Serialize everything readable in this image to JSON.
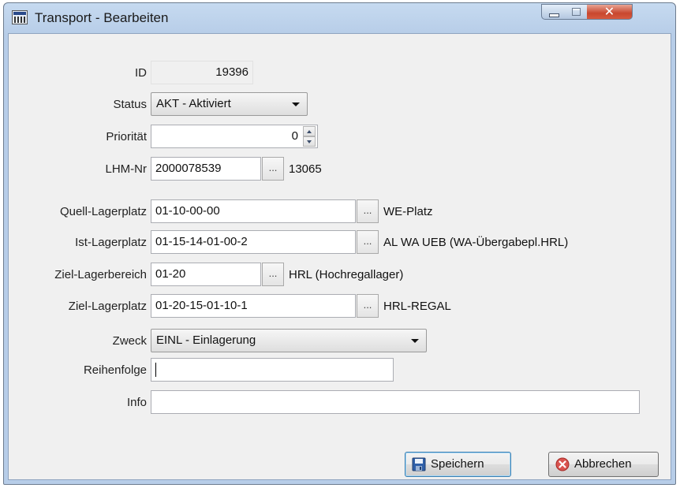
{
  "window": {
    "title": "Transport - Bearbeiten"
  },
  "fields": {
    "id": {
      "label": "ID",
      "value": "19396"
    },
    "status": {
      "label": "Status",
      "value": "AKT - Aktiviert"
    },
    "prioritaet": {
      "label": "Priorität",
      "value": "0"
    },
    "lhm_nr": {
      "label": "LHM-Nr",
      "value": "2000078539",
      "info": "13065"
    },
    "quell_lagerplatz": {
      "label": "Quell-Lagerplatz",
      "value": "01-10-00-00",
      "info": "WE-Platz"
    },
    "ist_lagerplatz": {
      "label": "Ist-Lagerplatz",
      "value": "01-15-14-01-00-2",
      "info": "AL WA UEB (WA-Übergabepl.HRL)"
    },
    "ziel_lagerbereich": {
      "label": "Ziel-Lagerbereich",
      "value": "01-20",
      "info": "HRL (Hochregallager)"
    },
    "ziel_lagerplatz": {
      "label": "Ziel-Lagerplatz",
      "value": "01-20-15-01-10-1",
      "info": "HRL-REGAL"
    },
    "zweck": {
      "label": "Zweck",
      "value": "EINL - Einlagerung"
    },
    "reihenfolge": {
      "label": "Reihenfolge",
      "value": ""
    },
    "info": {
      "label": "Info",
      "value": ""
    }
  },
  "browse_label": "...",
  "buttons": {
    "save": "Speichern",
    "cancel": "Abbrechen"
  },
  "colors": {
    "titlebar": "#b7cde8",
    "close": "#c8472f",
    "client": "#f0f0f0"
  }
}
